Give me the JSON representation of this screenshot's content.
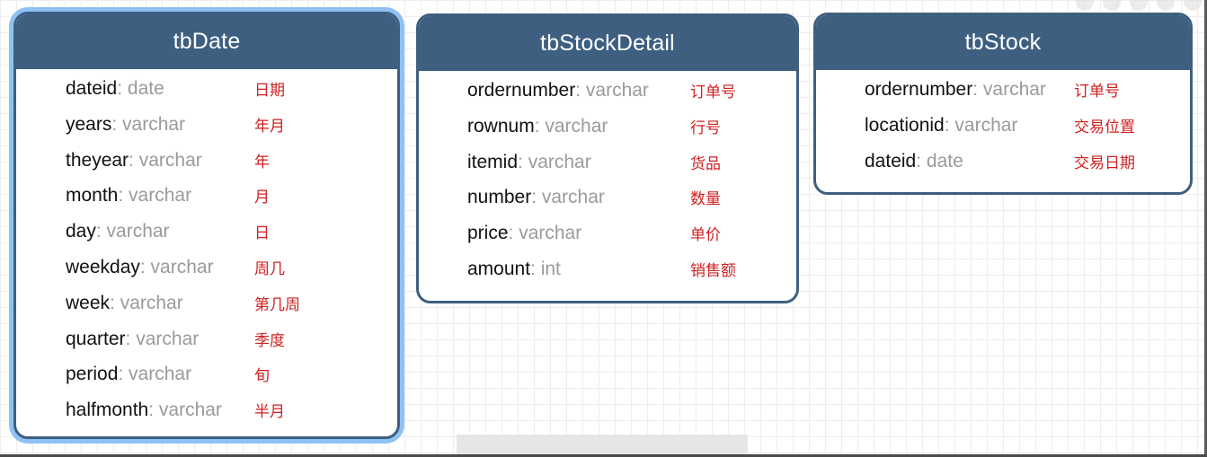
{
  "entities": [
    {
      "title": "tbDate",
      "fields": [
        {
          "name": "dateid",
          "type": ": date",
          "comment": "日期"
        },
        {
          "name": "years",
          "type": ": varchar",
          "comment": "年月"
        },
        {
          "name": "theyear",
          "type": ": varchar",
          "comment": "年"
        },
        {
          "name": "month",
          "type": ": varchar",
          "comment": "月"
        },
        {
          "name": "day",
          "type": ": varchar",
          "comment": "日"
        },
        {
          "name": "weekday",
          "type": ": varchar",
          "comment": "周几"
        },
        {
          "name": "week",
          "type": ": varchar",
          "comment": "第几周"
        },
        {
          "name": "quarter",
          "type": ": varchar",
          "comment": "季度"
        },
        {
          "name": "period",
          "type": ": varchar",
          "comment": "旬"
        },
        {
          "name": "halfmonth",
          "type": ": varchar",
          "comment": "半月"
        }
      ]
    },
    {
      "title": "tbStockDetail",
      "fields": [
        {
          "name": "ordernumber",
          "type": ": varchar",
          "comment": "订单号"
        },
        {
          "name": "rownum",
          "type": ": varchar",
          "comment": "行号"
        },
        {
          "name": "itemid",
          "type": ": varchar",
          "comment": "货品"
        },
        {
          "name": "number",
          "type": ": varchar",
          "comment": "数量"
        },
        {
          "name": "price",
          "type": ": varchar",
          "comment": "单价"
        },
        {
          "name": "amount",
          "type": ": int",
          "comment": "销售额"
        }
      ]
    },
    {
      "title": "tbStock",
      "fields": [
        {
          "name": "ordernumber",
          "type": ": varchar",
          "comment": "订单号"
        },
        {
          "name": "locationid",
          "type": ": varchar",
          "comment": "交易位置"
        },
        {
          "name": "dateid",
          "type": ": date",
          "comment": "交易日期"
        }
      ]
    }
  ],
  "colors": {
    "header": "#3e5f80",
    "selection": "#8fc1f4",
    "field_name": "#111111",
    "field_type": "#9a9a9a",
    "comment": "#d02020"
  }
}
